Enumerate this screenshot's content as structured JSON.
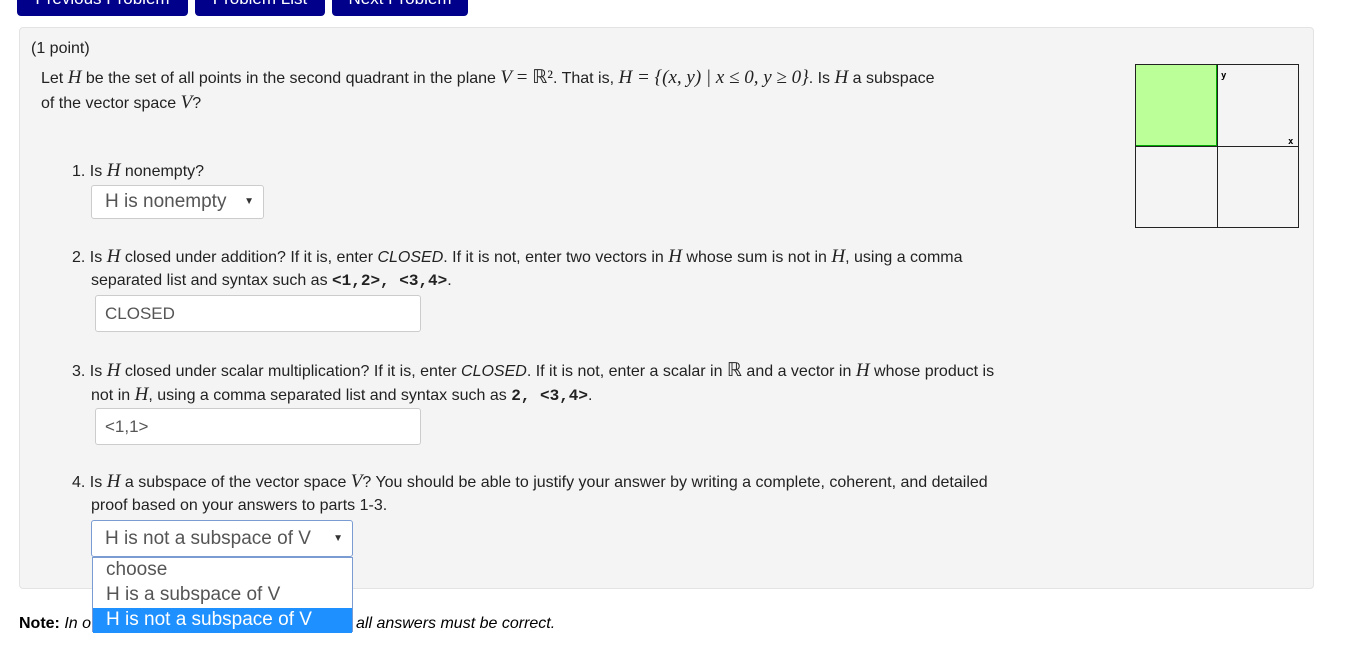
{
  "nav": {
    "prev": "Previous Problem",
    "list": "Problem List",
    "next": "Next Problem"
  },
  "problem": {
    "points": "(1 point)",
    "intro_1": "Let ",
    "H": "H",
    "intro_2": " be the set of all points in the second quadrant in the plane ",
    "V": "V",
    "eq_r2": " = ℝ²",
    "intro_3": ". That is, ",
    "set_def": "H = {(x, y) | x ≤ 0, y ≥ 0}",
    "intro_4": ". Is ",
    "intro_5": " a subspace",
    "intro_6": "of the vector space ",
    "intro_7": "?"
  },
  "graph": {
    "x_label": "x",
    "y_label": "y",
    "fill_color": "#bbff99",
    "shaded_quadrant": "second"
  },
  "q1": {
    "num": "1. Is ",
    "rest": " nonempty?",
    "select_value": "H is nonempty"
  },
  "q2": {
    "a": "2. Is ",
    "b": " closed under addition? If it is, enter ",
    "closed": "CLOSED",
    "c": ". If it is not, enter two vectors in ",
    "d": " whose sum is not in ",
    "e": ", using a comma",
    "f": "separated list and syntax such as ",
    "example": "<1,2>, <3,4>",
    "g": ".",
    "value": "CLOSED"
  },
  "q3": {
    "a": "3. Is ",
    "b": " closed under scalar multiplication? If it is, enter ",
    "closed": "CLOSED",
    "c": ". If it is not, enter a scalar in ",
    "R": "ℝ",
    "d": " and a vector in ",
    "e": " whose product is",
    "f": "not in ",
    "g": ", using a comma separated list and syntax such as ",
    "example": "2, <3,4>",
    "h": ".",
    "value": "<1,1>"
  },
  "q4": {
    "a": "4. Is ",
    "b": " a subspace of the vector space ",
    "c": "? You should be able to justify your answer by writing a complete, coherent, and detailed",
    "d": "proof based on your answers to parts 1-3.",
    "select_value": "H is not a subspace of V",
    "options": [
      "choose",
      "H is a subspace of V",
      "H is not a subspace of V"
    ]
  },
  "note": {
    "label": "Note:",
    "text_start": " In o",
    "text_end": "all answers must be correct."
  }
}
